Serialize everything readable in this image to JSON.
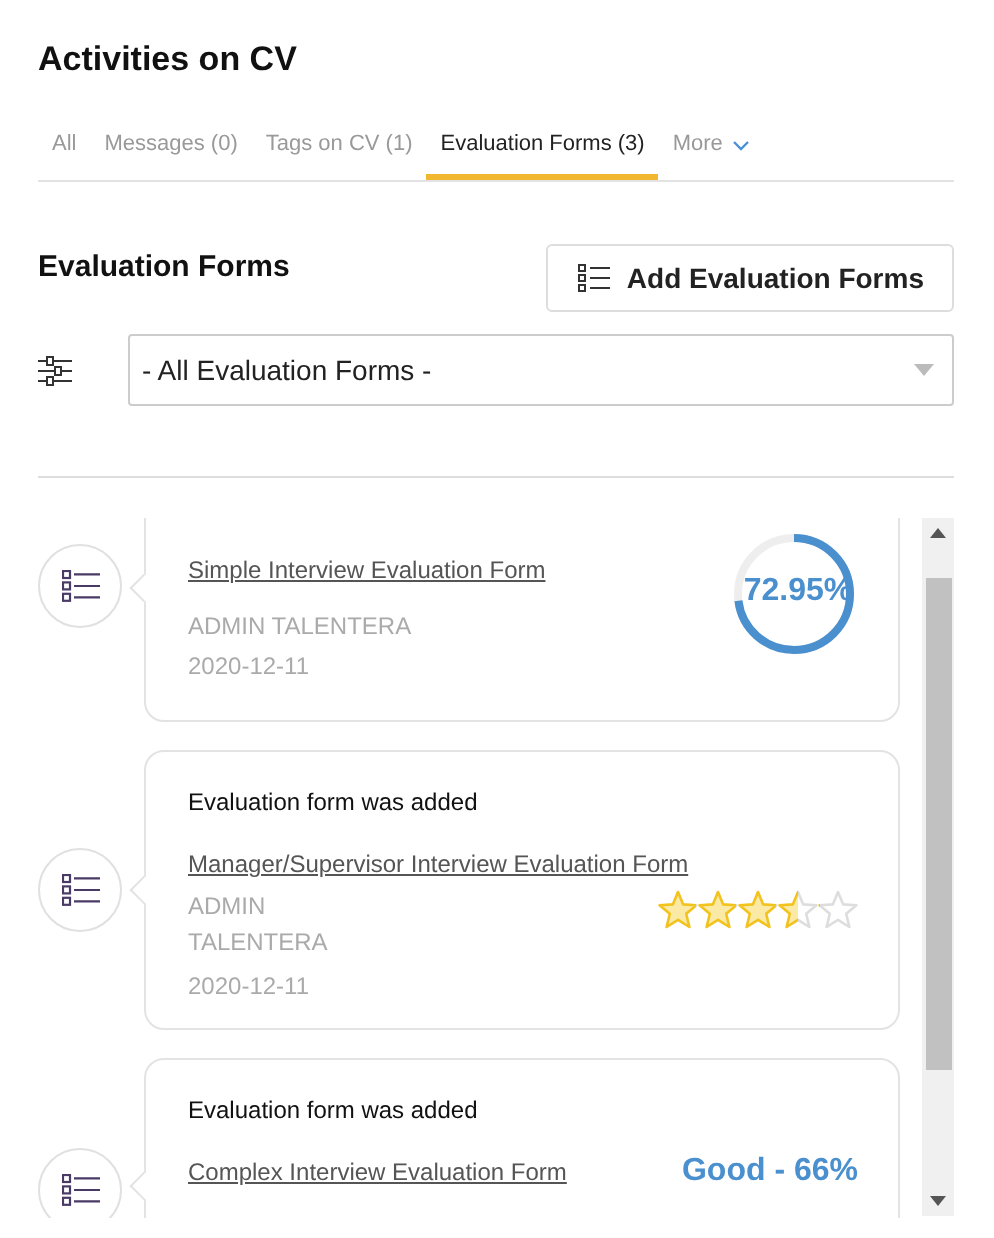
{
  "title": "Activities on CV",
  "tabs": [
    {
      "label": "All",
      "selected": false
    },
    {
      "label": "Messages (0)",
      "selected": false
    },
    {
      "label": "Tags on CV (1)",
      "selected": false
    },
    {
      "label": "Evaluation Forms (3)",
      "selected": true
    },
    {
      "label": "More",
      "selected": false,
      "dropdown": true
    }
  ],
  "section": {
    "title": "Evaluation Forms",
    "add_button": "Add Evaluation Forms",
    "filter": {
      "value": "- All Evaluation Forms -"
    }
  },
  "activities": [
    {
      "kind": "ring",
      "form": "Simple Interview Evaluation Form",
      "author": "ADMIN TALENTERA",
      "date": "2020-12-11",
      "score": "72.95%",
      "level": 0.7295
    },
    {
      "kind": "stars",
      "heading": "Evaluation form was added",
      "form": "Manager/Supervisor Interview Evaluation Form",
      "author": "ADMIN TALENTERA",
      "date": "2020-12-11",
      "stars": 3.5
    },
    {
      "kind": "text",
      "heading": "Evaluation form was added",
      "form": "Complex Interview Evaluation Form",
      "score": "Good - 66%"
    }
  ]
}
